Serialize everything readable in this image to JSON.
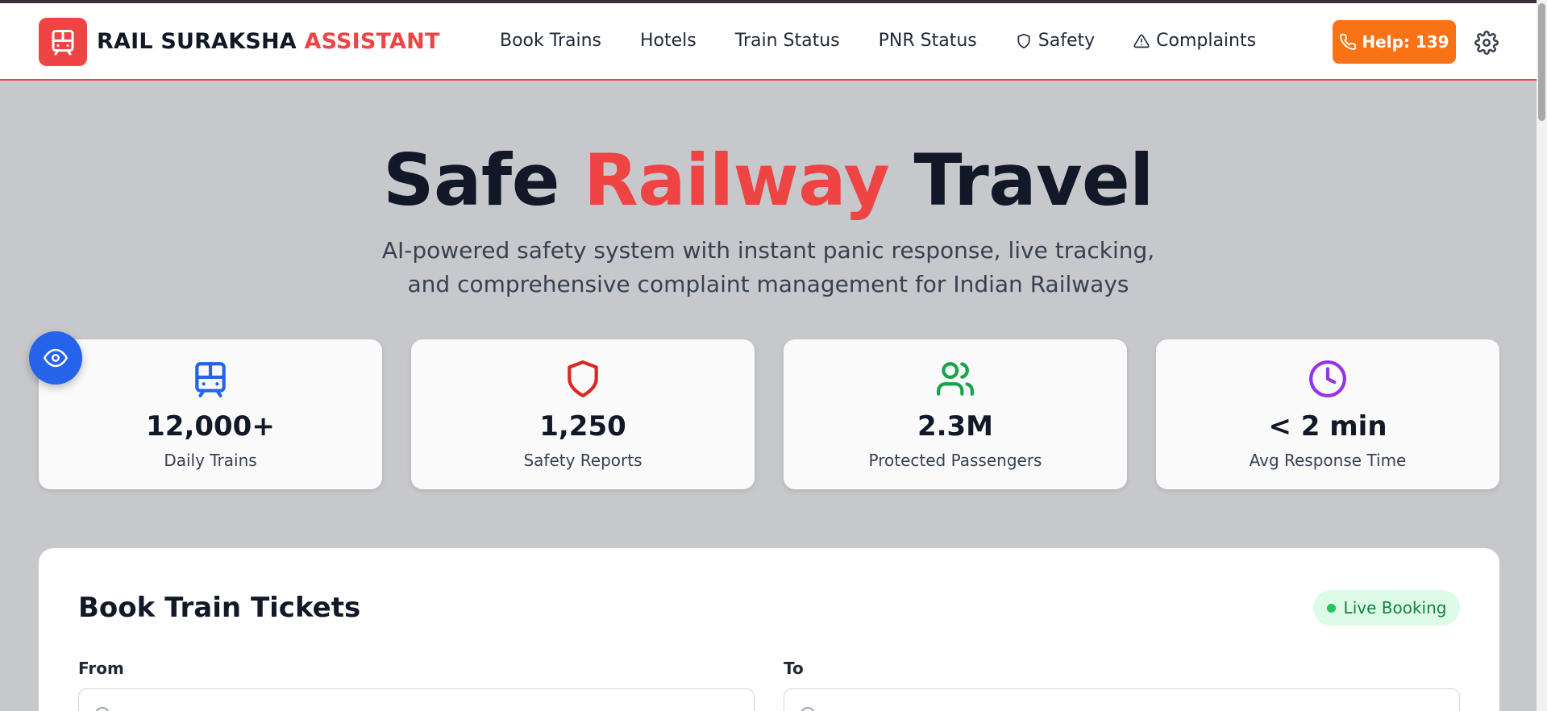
{
  "header": {
    "brand_part1": "RAIL SURAKSHA ",
    "brand_part2": "ASSISTANT",
    "nav": [
      {
        "label": "Book Trains"
      },
      {
        "label": "Hotels"
      },
      {
        "label": "Train Status"
      },
      {
        "label": "PNR Status"
      },
      {
        "label": "Safety",
        "icon": "shield-icon"
      },
      {
        "label": "Complaints",
        "icon": "warning-icon"
      }
    ],
    "help_label": "Help: 139",
    "help_icon": "phone-icon",
    "settings_icon": "gear-icon"
  },
  "hero": {
    "title_part1": "Safe ",
    "title_part2": "Railway",
    "title_part3": " Travel",
    "subtitle": "AI-powered safety system with instant panic response, live tracking, and comprehensive complaint management for Indian Railways"
  },
  "stats": [
    {
      "icon": "train-icon",
      "value": "12,000+",
      "label": "Daily Trains",
      "color": "#2563eb"
    },
    {
      "icon": "shield-icon",
      "value": "1,250",
      "label": "Safety Reports",
      "color": "#dc2626"
    },
    {
      "icon": "users-icon",
      "value": "2.3M",
      "label": "Protected Passengers",
      "color": "#16a34a"
    },
    {
      "icon": "clock-icon",
      "value": "< 2 min",
      "label": "Avg Response Time",
      "color": "#9333ea"
    }
  ],
  "booking": {
    "title": "Book Train Tickets",
    "badge": "Live Booking",
    "from_label": "From",
    "to_label": "To"
  },
  "colors": {
    "brand_red": "#ef4444",
    "help_orange": "#f97316",
    "accessibility_blue": "#2563eb",
    "live_green": "#22c55e"
  }
}
